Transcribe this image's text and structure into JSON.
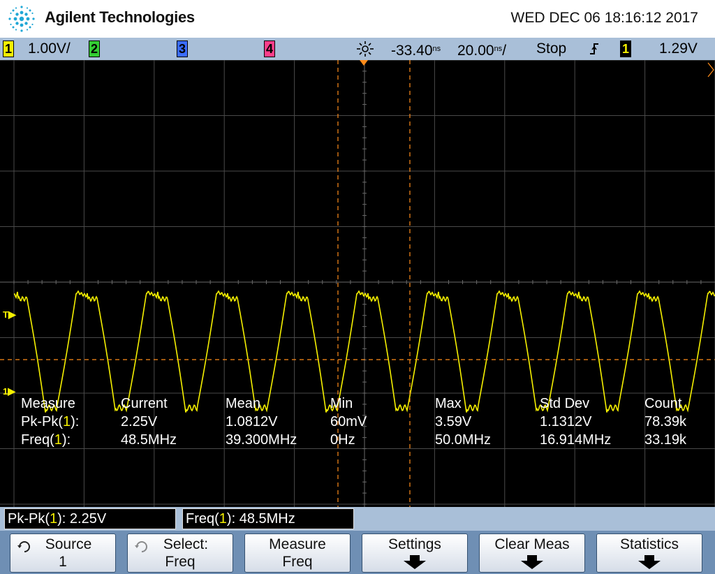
{
  "header": {
    "brand": "Agilent Technologies",
    "datetime": "WED DEC 06 18:16:12 2017"
  },
  "status": {
    "ch1_num": "1",
    "ch1_scale": "1.00V/",
    "ch2_num": "2",
    "ch3_num": "3",
    "ch4_num": "4",
    "delay": "-33.40",
    "delay_unit": "ns",
    "timebase": "20.00",
    "timebase_unit": "ns",
    "timebase_suffix": "/",
    "run_state": "Stop",
    "trig_source": "1",
    "trig_level": "1.29V"
  },
  "markers": {
    "trigger": "T",
    "ground": "1"
  },
  "measurements": {
    "headers": [
      "Measure",
      "Current",
      "Mean",
      "Min",
      "Max",
      "Std Dev",
      "Count"
    ],
    "rows": [
      {
        "name_pre": "Pk-Pk(",
        "ch": "1",
        "name_post": "):",
        "current": "2.25V",
        "mean": "1.0812V",
        "min": "60mV",
        "max": "3.59V",
        "std": "1.1312V",
        "count": "78.39k"
      },
      {
        "name_pre": "Freq(",
        "ch": "1",
        "name_post": "):",
        "current": "48.5MHz",
        "mean": "39.300MHz",
        "min": "0Hz",
        "max": "50.0MHz",
        "std": "16.914MHz",
        "count": "33.19k"
      }
    ]
  },
  "readouts": [
    {
      "pre": "Pk-Pk(",
      "ch": "1",
      "post": "): 2.25V"
    },
    {
      "pre": "Freq(",
      "ch": "1",
      "post": "): 48.5MHz"
    }
  ],
  "softkeys": [
    {
      "line1": "Source",
      "line2": "1"
    },
    {
      "line1": "Select:",
      "line2": "Freq"
    },
    {
      "line1": "Measure",
      "line2": "Freq"
    },
    {
      "line1": "Settings",
      "line2": ""
    },
    {
      "line1": "Clear Meas",
      "line2": ""
    },
    {
      "line1": "Statistics",
      "line2": ""
    }
  ],
  "colors": {
    "ch1": "#f5f000",
    "ch2": "#33cc33",
    "ch3": "#3a6cff",
    "ch4": "#ff3e8a",
    "cursor": "#ff8c1a",
    "bar": "#a9bfd8"
  },
  "icons": {
    "logo": "agilent-spark-icon",
    "delay": "delay-sun-icon",
    "trigger_edge": "rising-edge-icon",
    "source_key": "rotate-knob-icon",
    "select_key": "rotate-knob-icon",
    "submenu": "down-arrow-icon"
  }
}
